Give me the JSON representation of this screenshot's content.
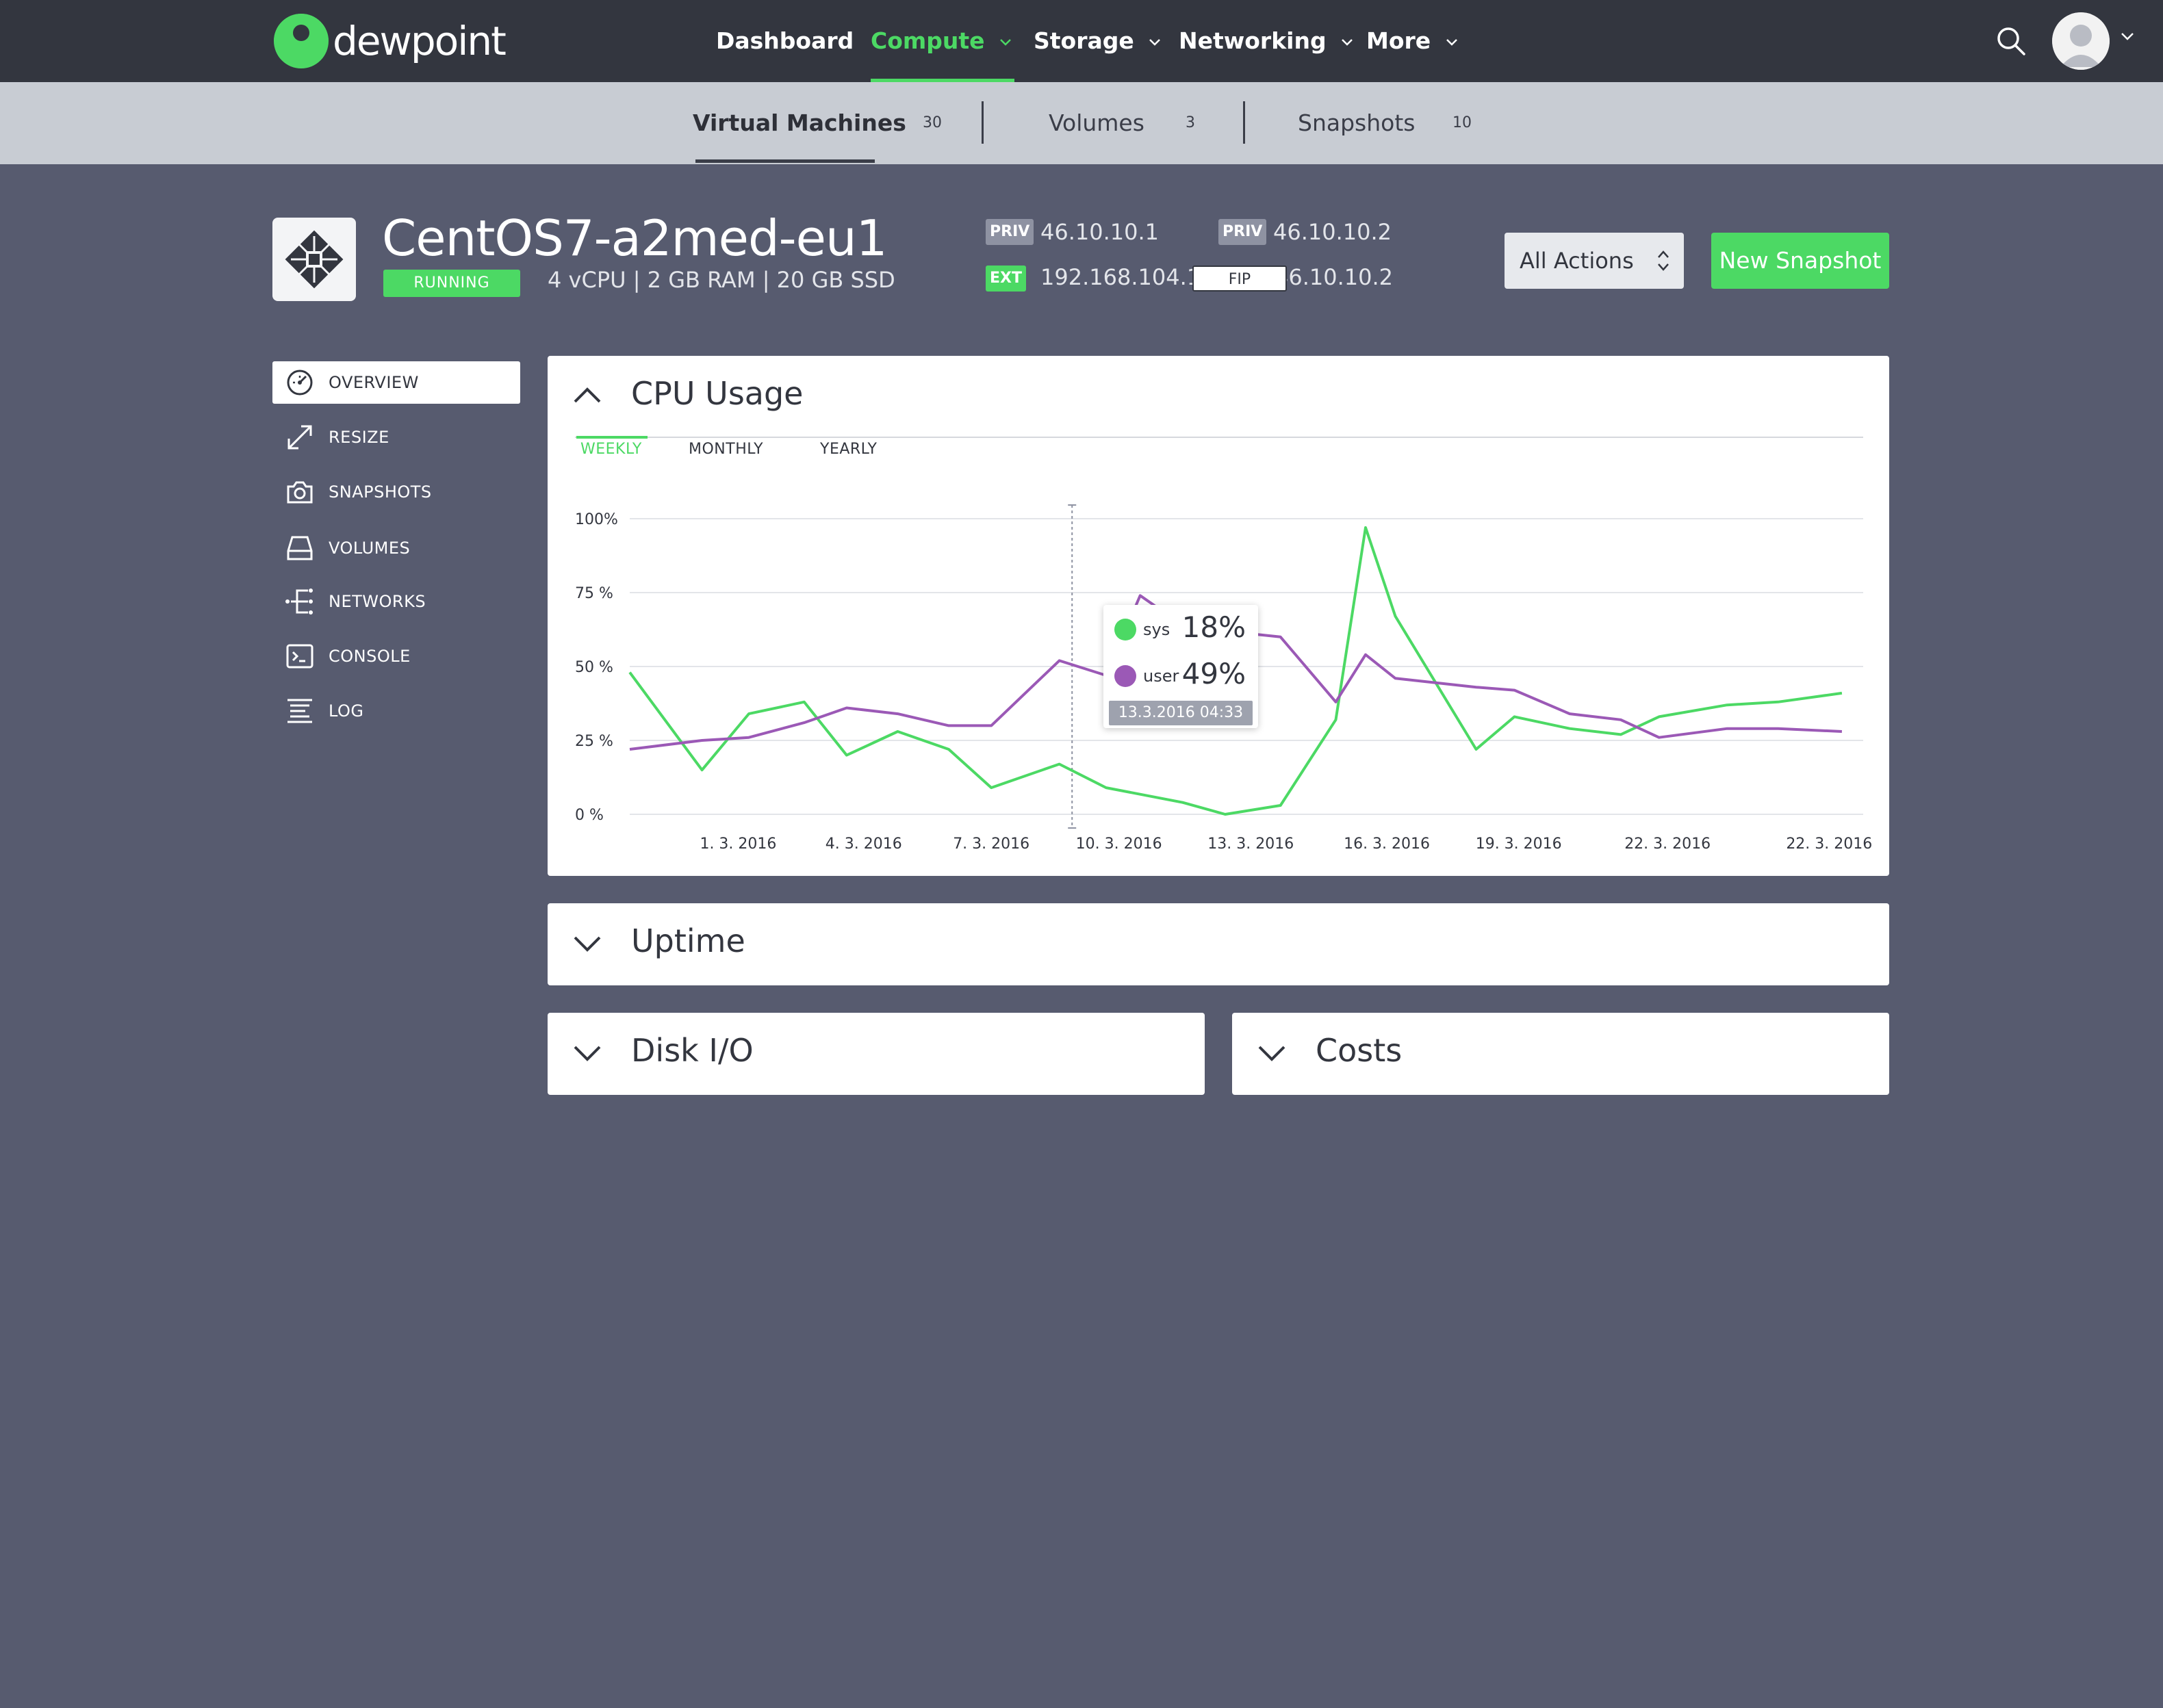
{
  "brand": {
    "name": "dewpoint"
  },
  "nav": {
    "items": [
      {
        "label": "Dashboard",
        "active": false,
        "dropdown": false
      },
      {
        "label": "Compute",
        "active": true,
        "dropdown": true
      },
      {
        "label": "Storage",
        "active": false,
        "dropdown": true
      },
      {
        "label": "Networking",
        "active": false,
        "dropdown": true
      },
      {
        "label": "More",
        "active": false,
        "dropdown": true
      }
    ],
    "search_icon": "search-icon",
    "avatar_icon": "user-avatar-icon"
  },
  "subnav": {
    "items": [
      {
        "label": "Virtual Machines",
        "count": "30",
        "active": true
      },
      {
        "label": "Volumes",
        "count": "3",
        "active": false
      },
      {
        "label": "Snapshots",
        "count": "10",
        "active": false
      }
    ]
  },
  "vm": {
    "name": "CentOS7-a2med-eu1",
    "status": "RUNNING",
    "specs": "4 vCPU | 2 GB RAM | 20 GB SSD",
    "ips": {
      "priv1_tag": "PRIV",
      "priv1": "46.10.10.1",
      "priv2_tag": "PRIV",
      "priv2": "46.10.10.2",
      "ext_tag": "EXT",
      "ext": "192.168.104.100",
      "fip_tag": "FIP",
      "fip": "46.10.10.2"
    },
    "actions_label": "All Actions",
    "new_snapshot_label": "New Snapshot"
  },
  "side_menu": {
    "items": [
      {
        "label": "OVERVIEW",
        "icon": "speedometer-icon",
        "active": true
      },
      {
        "label": "RESIZE",
        "icon": "resize-arrows-icon",
        "active": false
      },
      {
        "label": "SNAPSHOTS",
        "icon": "camera-icon",
        "active": false
      },
      {
        "label": "VOLUMES",
        "icon": "hard-drive-icon",
        "active": false
      },
      {
        "label": "NETWORKS",
        "icon": "network-icon",
        "active": false
      },
      {
        "label": "CONSOLE",
        "icon": "terminal-icon",
        "active": false
      },
      {
        "label": "LOG",
        "icon": "log-lines-icon",
        "active": false
      }
    ]
  },
  "panels": {
    "cpu": {
      "title": "CPU Usage",
      "tabs": [
        "WEEKLY",
        "MONTHLY",
        "YEARLY"
      ],
      "active_tab": "WEEKLY"
    },
    "uptime": {
      "title": "Uptime"
    },
    "disk": {
      "title": "Disk I/O"
    },
    "costs": {
      "title": "Costs"
    }
  },
  "tooltip": {
    "sys_label": "sys",
    "sys_value": "18%",
    "user_label": "user",
    "user_value": "49%",
    "date": "13.3.2016 04:33"
  },
  "colors": {
    "accent": "#4cd964",
    "user_series": "#9b59b6",
    "topbar": "#33363f",
    "background": "#575b6f"
  },
  "chart_data": {
    "type": "line",
    "y_tick_labels": [
      "100%",
      "75 %",
      "50 %",
      "25 %",
      "0 %"
    ],
    "y_ticks": [
      100,
      75,
      50,
      25,
      0
    ],
    "ylim": [
      0,
      100
    ],
    "x_tick_labels": [
      "1. 3. 2016",
      "4. 3. 2016",
      "7. 3. 2016",
      "10. 3. 2016",
      "13. 3. 2016",
      "16. 3. 2016",
      "19. 3. 2016",
      "22. 3. 2016",
      "22. 3. 2016"
    ],
    "x_tick_positions": [
      2.55,
      5.5,
      8.5,
      11.5,
      14.6,
      17.8,
      20.9,
      24.4,
      28.2
    ],
    "xlim": [
      0,
      29
    ],
    "grid": true,
    "legend": "tooltip",
    "hover_x": 10.4,
    "series": [
      {
        "name": "sys",
        "color": "#4cd964",
        "x": [
          0,
          1.7,
          2.8,
          4.1,
          5.1,
          6.3,
          7.5,
          8.5,
          10.1,
          11.2,
          13.0,
          14.0,
          15.3,
          16.6,
          17.3,
          18.0,
          19.9,
          20.8,
          22.1,
          23.3,
          24.2,
          25.8,
          27.0,
          28.5
        ],
        "y": [
          48,
          15,
          34,
          38,
          20,
          28,
          22,
          9,
          17,
          9,
          4,
          0,
          3,
          32,
          97,
          67,
          22,
          33,
          29,
          27,
          33,
          37,
          38,
          41
        ]
      },
      {
        "name": "user",
        "color": "#9b59b6",
        "x": [
          0,
          1.7,
          2.8,
          4.1,
          5.1,
          6.3,
          7.5,
          8.5,
          10.1,
          11.2,
          12.0,
          12.4,
          14.0,
          15.3,
          16.6,
          17.3,
          18.0,
          19.9,
          20.8,
          22.1,
          23.3,
          24.2,
          25.8,
          27.0,
          28.5
        ],
        "y": [
          22,
          25,
          26,
          31,
          36,
          34,
          30,
          30,
          52,
          47,
          74,
          70,
          62,
          60,
          38,
          54,
          46,
          43,
          42,
          34,
          32,
          26,
          29,
          29,
          28
        ]
      }
    ]
  }
}
